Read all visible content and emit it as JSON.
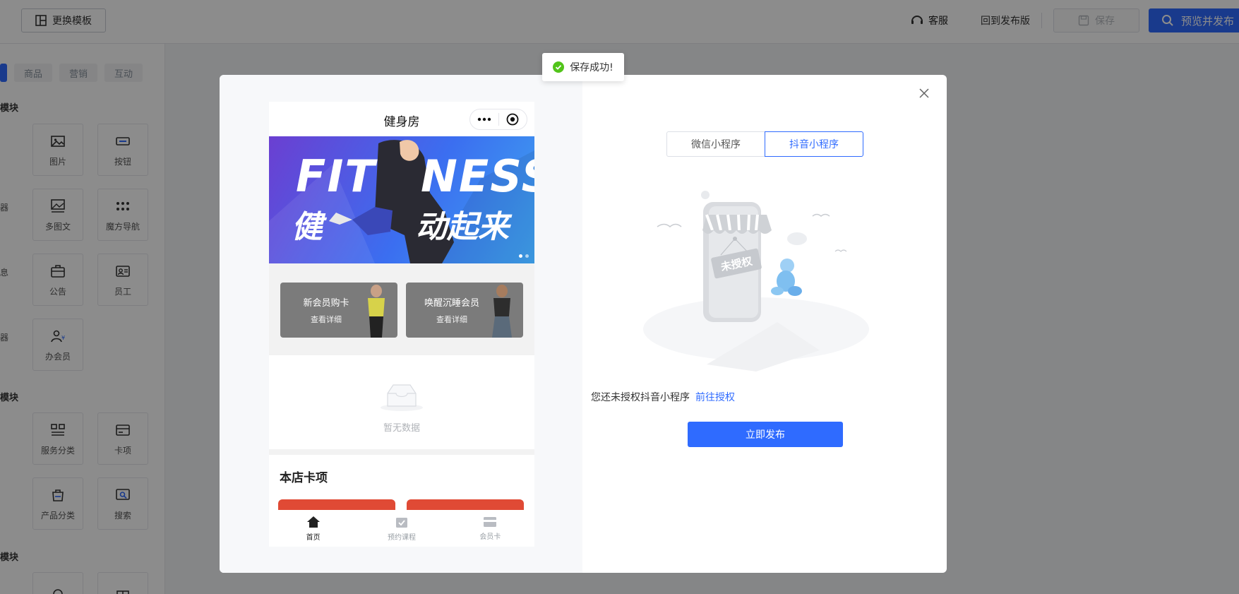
{
  "topbar": {
    "template_button": "更换模板",
    "service": "客服",
    "back_to_published": "回到发布版",
    "save": "保存",
    "preview_publish": "预览并发布"
  },
  "left_panel": {
    "tabs": [
      "商品",
      "营销",
      "互动"
    ],
    "sections": [
      "模块",
      "模块",
      "模块"
    ],
    "tiles": {
      "image": "图片",
      "button": "按钮",
      "multi_image_text": "多图文",
      "magic_nav": "魔方导航",
      "notice": "公告",
      "staff": "员工",
      "membership": "办会员",
      "service_category": "服务分类",
      "card_item": "卡项",
      "product_category": "产品分类",
      "search": "搜索"
    },
    "cut_labels": [
      "器",
      "息",
      "器"
    ]
  },
  "toast": {
    "text": "保存成功!"
  },
  "modal": {
    "phone": {
      "title": "健身房",
      "banner_en_left": "FIT",
      "banner_en_right": "NESS",
      "banner_cn_left": "健",
      "banner_cn_right": "动起来",
      "cards": [
        {
          "title": "新会员购卡",
          "sub": "查看详细"
        },
        {
          "title": "唤醒沉睡会员",
          "sub": "查看详细"
        }
      ],
      "empty_text": "暂无数据",
      "store_section": "本店卡项",
      "tabbar": [
        "首页",
        "预约课程",
        "会员卡"
      ]
    },
    "segments": [
      "微信小程序",
      "抖音小程序"
    ],
    "illustration_sign": "未授权",
    "unauth_text": "您还未授权抖音小程序",
    "unauth_link": "前往授权",
    "publish_button": "立即发布"
  },
  "colors": {
    "primary": "#2f6bff",
    "success": "#52c41a",
    "card_red": "#e04a35"
  }
}
